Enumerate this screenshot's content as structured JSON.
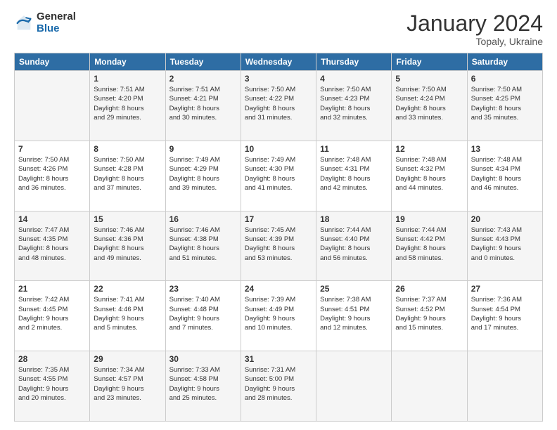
{
  "logo": {
    "general": "General",
    "blue": "Blue"
  },
  "header": {
    "title": "January 2024",
    "subtitle": "Topaly, Ukraine"
  },
  "weekdays": [
    "Sunday",
    "Monday",
    "Tuesday",
    "Wednesday",
    "Thursday",
    "Friday",
    "Saturday"
  ],
  "weeks": [
    [
      {
        "day": "",
        "info": ""
      },
      {
        "day": "1",
        "info": "Sunrise: 7:51 AM\nSunset: 4:20 PM\nDaylight: 8 hours\nand 29 minutes."
      },
      {
        "day": "2",
        "info": "Sunrise: 7:51 AM\nSunset: 4:21 PM\nDaylight: 8 hours\nand 30 minutes."
      },
      {
        "day": "3",
        "info": "Sunrise: 7:50 AM\nSunset: 4:22 PM\nDaylight: 8 hours\nand 31 minutes."
      },
      {
        "day": "4",
        "info": "Sunrise: 7:50 AM\nSunset: 4:23 PM\nDaylight: 8 hours\nand 32 minutes."
      },
      {
        "day": "5",
        "info": "Sunrise: 7:50 AM\nSunset: 4:24 PM\nDaylight: 8 hours\nand 33 minutes."
      },
      {
        "day": "6",
        "info": "Sunrise: 7:50 AM\nSunset: 4:25 PM\nDaylight: 8 hours\nand 35 minutes."
      }
    ],
    [
      {
        "day": "7",
        "info": "Sunrise: 7:50 AM\nSunset: 4:26 PM\nDaylight: 8 hours\nand 36 minutes."
      },
      {
        "day": "8",
        "info": "Sunrise: 7:50 AM\nSunset: 4:28 PM\nDaylight: 8 hours\nand 37 minutes."
      },
      {
        "day": "9",
        "info": "Sunrise: 7:49 AM\nSunset: 4:29 PM\nDaylight: 8 hours\nand 39 minutes."
      },
      {
        "day": "10",
        "info": "Sunrise: 7:49 AM\nSunset: 4:30 PM\nDaylight: 8 hours\nand 41 minutes."
      },
      {
        "day": "11",
        "info": "Sunrise: 7:48 AM\nSunset: 4:31 PM\nDaylight: 8 hours\nand 42 minutes."
      },
      {
        "day": "12",
        "info": "Sunrise: 7:48 AM\nSunset: 4:32 PM\nDaylight: 8 hours\nand 44 minutes."
      },
      {
        "day": "13",
        "info": "Sunrise: 7:48 AM\nSunset: 4:34 PM\nDaylight: 8 hours\nand 46 minutes."
      }
    ],
    [
      {
        "day": "14",
        "info": "Sunrise: 7:47 AM\nSunset: 4:35 PM\nDaylight: 8 hours\nand 48 minutes."
      },
      {
        "day": "15",
        "info": "Sunrise: 7:46 AM\nSunset: 4:36 PM\nDaylight: 8 hours\nand 49 minutes."
      },
      {
        "day": "16",
        "info": "Sunrise: 7:46 AM\nSunset: 4:38 PM\nDaylight: 8 hours\nand 51 minutes."
      },
      {
        "day": "17",
        "info": "Sunrise: 7:45 AM\nSunset: 4:39 PM\nDaylight: 8 hours\nand 53 minutes."
      },
      {
        "day": "18",
        "info": "Sunrise: 7:44 AM\nSunset: 4:40 PM\nDaylight: 8 hours\nand 56 minutes."
      },
      {
        "day": "19",
        "info": "Sunrise: 7:44 AM\nSunset: 4:42 PM\nDaylight: 8 hours\nand 58 minutes."
      },
      {
        "day": "20",
        "info": "Sunrise: 7:43 AM\nSunset: 4:43 PM\nDaylight: 9 hours\nand 0 minutes."
      }
    ],
    [
      {
        "day": "21",
        "info": "Sunrise: 7:42 AM\nSunset: 4:45 PM\nDaylight: 9 hours\nand 2 minutes."
      },
      {
        "day": "22",
        "info": "Sunrise: 7:41 AM\nSunset: 4:46 PM\nDaylight: 9 hours\nand 5 minutes."
      },
      {
        "day": "23",
        "info": "Sunrise: 7:40 AM\nSunset: 4:48 PM\nDaylight: 9 hours\nand 7 minutes."
      },
      {
        "day": "24",
        "info": "Sunrise: 7:39 AM\nSunset: 4:49 PM\nDaylight: 9 hours\nand 10 minutes."
      },
      {
        "day": "25",
        "info": "Sunrise: 7:38 AM\nSunset: 4:51 PM\nDaylight: 9 hours\nand 12 minutes."
      },
      {
        "day": "26",
        "info": "Sunrise: 7:37 AM\nSunset: 4:52 PM\nDaylight: 9 hours\nand 15 minutes."
      },
      {
        "day": "27",
        "info": "Sunrise: 7:36 AM\nSunset: 4:54 PM\nDaylight: 9 hours\nand 17 minutes."
      }
    ],
    [
      {
        "day": "28",
        "info": "Sunrise: 7:35 AM\nSunset: 4:55 PM\nDaylight: 9 hours\nand 20 minutes."
      },
      {
        "day": "29",
        "info": "Sunrise: 7:34 AM\nSunset: 4:57 PM\nDaylight: 9 hours\nand 23 minutes."
      },
      {
        "day": "30",
        "info": "Sunrise: 7:33 AM\nSunset: 4:58 PM\nDaylight: 9 hours\nand 25 minutes."
      },
      {
        "day": "31",
        "info": "Sunrise: 7:31 AM\nSunset: 5:00 PM\nDaylight: 9 hours\nand 28 minutes."
      },
      {
        "day": "",
        "info": ""
      },
      {
        "day": "",
        "info": ""
      },
      {
        "day": "",
        "info": ""
      }
    ]
  ]
}
